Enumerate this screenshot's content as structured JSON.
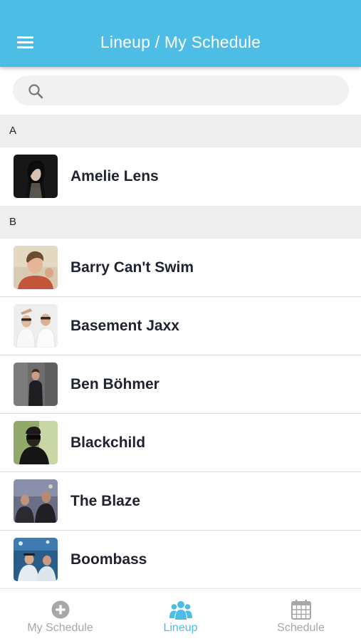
{
  "header": {
    "title": "Lineup / My Schedule",
    "menu_icon": "hamburger-menu-icon",
    "background": "#4dbde6"
  },
  "search": {
    "placeholder": "",
    "value": "",
    "icon": "search-icon"
  },
  "sections": [
    {
      "letter": "A",
      "artists": [
        {
          "name": "Amelie Lens"
        }
      ]
    },
    {
      "letter": "B",
      "artists": [
        {
          "name": "Barry Can't Swim"
        },
        {
          "name": "Basement Jaxx"
        },
        {
          "name": "Ben Böhmer"
        },
        {
          "name": "Blackchild"
        },
        {
          "name": "The Blaze"
        },
        {
          "name": "Boombass"
        }
      ]
    }
  ],
  "tabbar": {
    "tabs": [
      {
        "label": "My Schedule",
        "icon": "plus-circle-icon",
        "active": false
      },
      {
        "label": "Lineup",
        "icon": "group-icon",
        "active": true
      },
      {
        "label": "Schedule",
        "icon": "calendar-icon",
        "active": false
      }
    ],
    "active_color": "#4dbde6",
    "inactive_color": "#a7a7a7"
  }
}
